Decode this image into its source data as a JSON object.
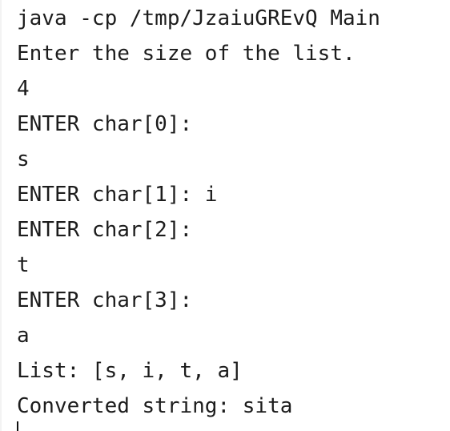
{
  "console": {
    "lines": [
      "java -cp /tmp/JzaiuGREvQ Main",
      "Enter the size of the list.",
      "4",
      "ENTER char[0]:",
      "s",
      "ENTER char[1]: i",
      "ENTER char[2]:",
      "t",
      "ENTER char[3]:",
      "a",
      "List: [s, i, t, a]",
      "Converted string: sita"
    ]
  }
}
